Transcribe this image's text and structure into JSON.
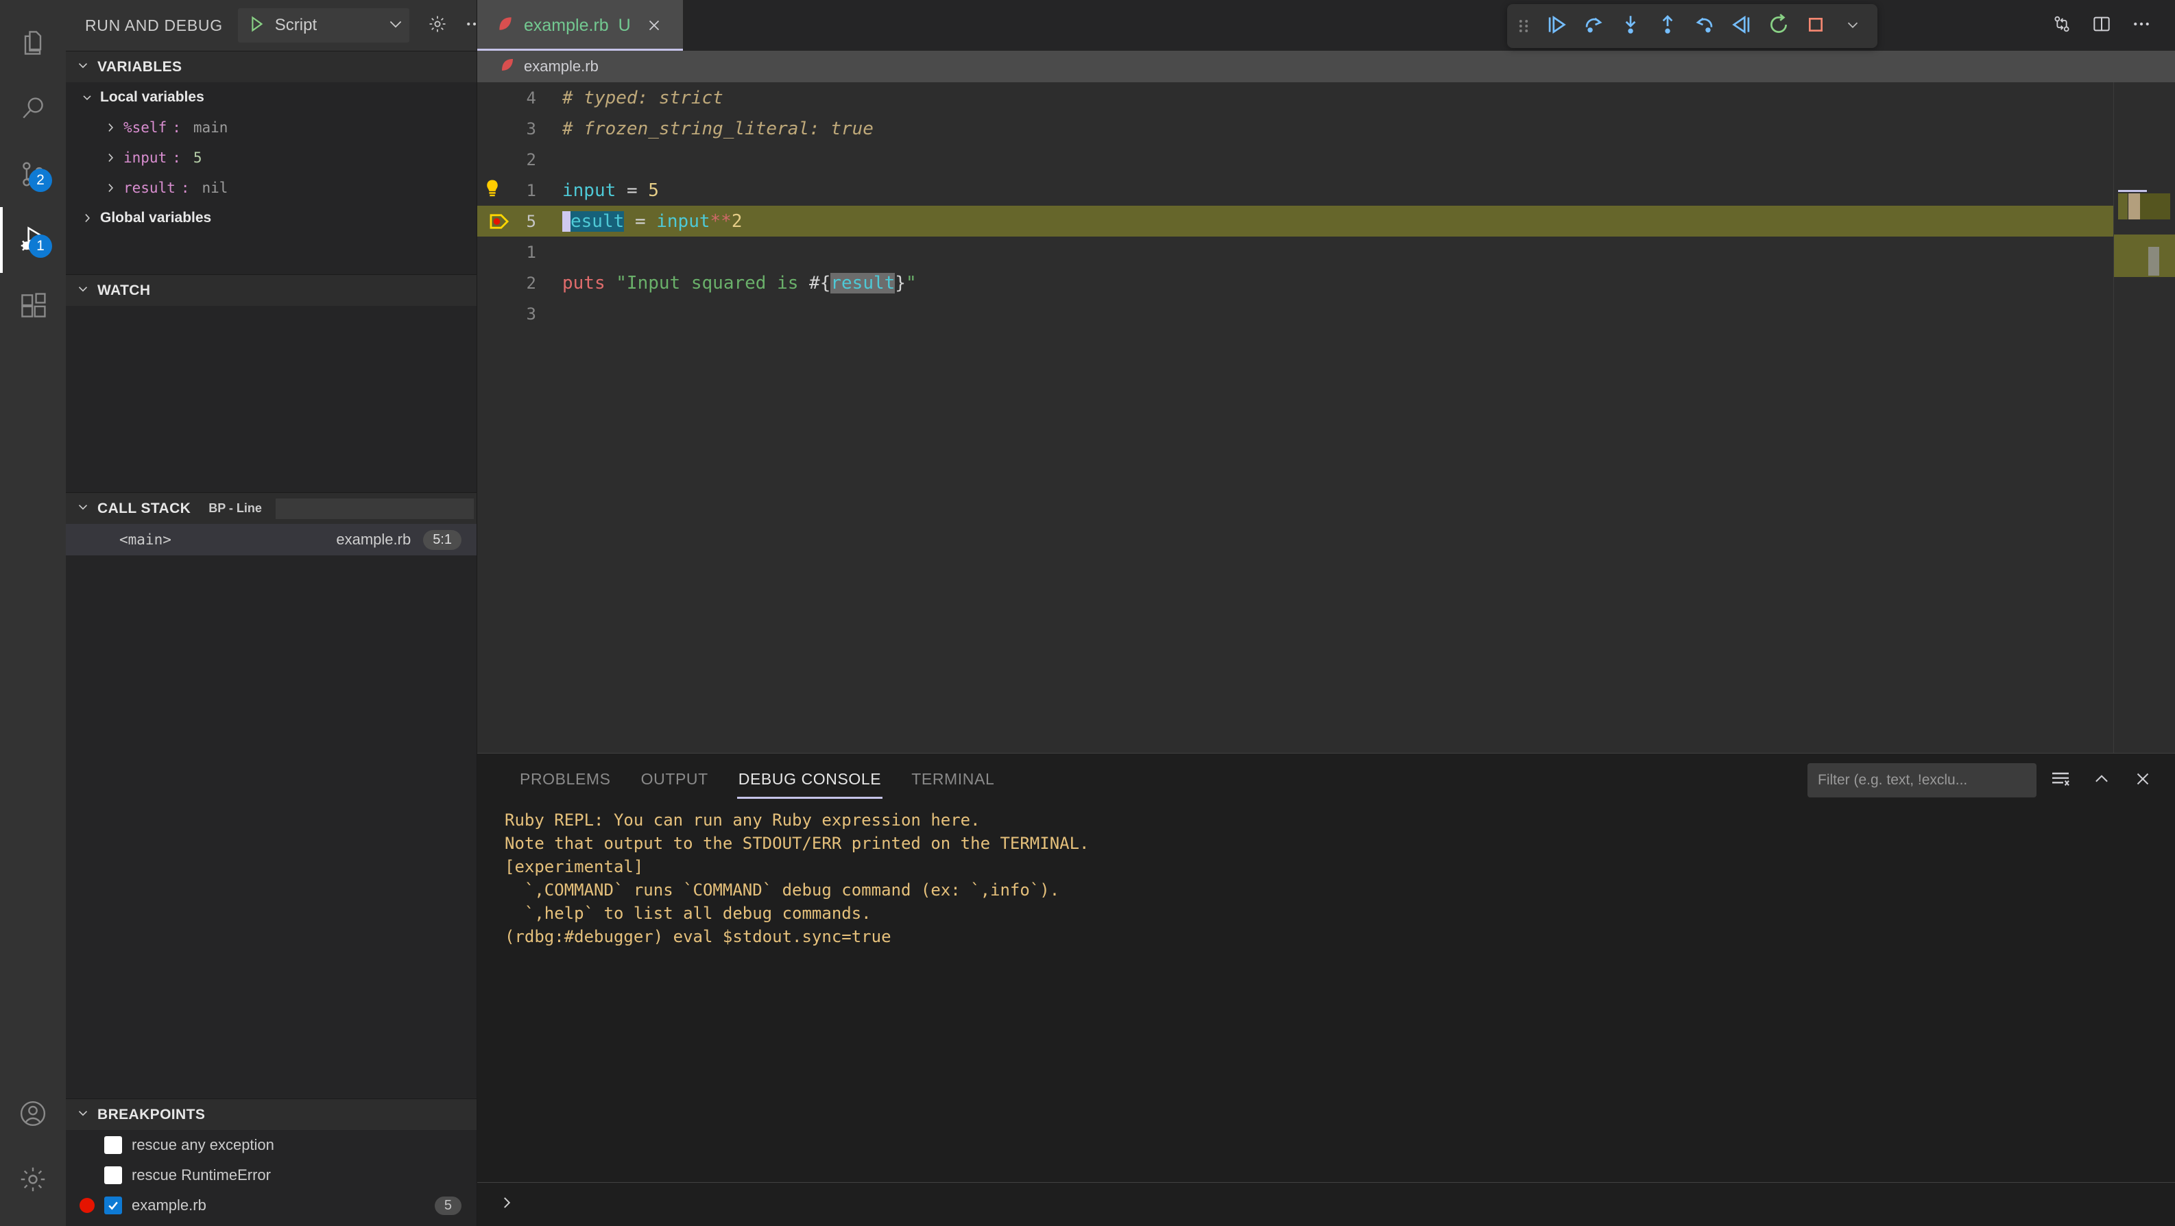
{
  "activitybar": {
    "items": [
      {
        "name": "explorer-icon",
        "label": "Explorer",
        "badge": ""
      },
      {
        "name": "search-icon",
        "label": "Search",
        "badge": ""
      },
      {
        "name": "source-control-icon",
        "label": "Source Control",
        "badge": "2"
      },
      {
        "name": "run-and-debug-icon",
        "label": "Run and Debug",
        "badge": "1"
      },
      {
        "name": "extensions-icon",
        "label": "Extensions",
        "badge": ""
      }
    ],
    "bottom": [
      {
        "name": "account-icon",
        "label": "Accounts"
      },
      {
        "name": "manage-gear-icon",
        "label": "Manage"
      }
    ]
  },
  "sidebar": {
    "title": "RUN AND DEBUG",
    "launch_configuration": "Script",
    "actions": {
      "settings_label": "Open launch.json",
      "more_label": "Views and More Actions..."
    },
    "variables": {
      "header": "VARIABLES",
      "groups": [
        {
          "label": "Local variables",
          "expanded": true,
          "items": [
            {
              "name": "%self",
              "value": "main",
              "kind": "string"
            },
            {
              "name": "input",
              "value": "5",
              "kind": "number"
            },
            {
              "name": "result",
              "value": "nil",
              "kind": "string"
            }
          ]
        },
        {
          "label": "Global variables",
          "expanded": false,
          "items": []
        }
      ]
    },
    "watch": {
      "header": "WATCH",
      "items": []
    },
    "call_stack": {
      "header": "CALL STACK",
      "status": "BP - Line",
      "frames": [
        {
          "frame": "<main>",
          "file": "example.rb",
          "position": "5:1"
        }
      ]
    },
    "breakpoints": {
      "header": "BREAKPOINTS",
      "items": [
        {
          "label": "rescue any exception",
          "checked": false,
          "line": "",
          "has_dot": false
        },
        {
          "label": "rescue RuntimeError",
          "checked": false,
          "line": "",
          "has_dot": false
        },
        {
          "label": "example.rb",
          "checked": true,
          "line": "5",
          "has_dot": true
        }
      ]
    }
  },
  "editor": {
    "tabs": [
      {
        "label": "example.rb",
        "badge": "U",
        "active": true,
        "close_label": "Close"
      }
    ],
    "tabbar_actions": [
      {
        "name": "compare-changes-icon",
        "label": "Compare Changes"
      },
      {
        "name": "split-editor-icon",
        "label": "Split Editor Right"
      },
      {
        "name": "more-actions-icon",
        "label": "More Actions..."
      }
    ],
    "breadcrumb": "example.rb",
    "debug_toolbar": [
      {
        "name": "drag-handle-icon",
        "label": "Drag"
      },
      {
        "name": "continue-icon",
        "label": "Continue"
      },
      {
        "name": "step-over-icon",
        "label": "Step Over"
      },
      {
        "name": "step-into-icon",
        "label": "Step Into"
      },
      {
        "name": "step-out-icon",
        "label": "Step Out"
      },
      {
        "name": "step-back-icon",
        "label": "Step Back"
      },
      {
        "name": "reverse-continue-icon",
        "label": "Reverse Continue"
      },
      {
        "name": "restart-icon",
        "label": "Restart"
      },
      {
        "name": "stop-icon",
        "label": "Stop"
      },
      {
        "name": "session-dropdown-icon",
        "label": "Select Session"
      }
    ],
    "lines": [
      {
        "number": "4",
        "text": "# typed: strict"
      },
      {
        "number": "3",
        "text": "# frozen_string_literal: true"
      },
      {
        "number": "2",
        "text": ""
      },
      {
        "number": "1",
        "text": "input = 5"
      },
      {
        "number": "5",
        "text": "result = input**2",
        "current": true,
        "breakpoint": true
      },
      {
        "number": "1",
        "text": ""
      },
      {
        "number": "2",
        "text": "puts \"Input squared is #{result}\""
      },
      {
        "number": "3",
        "text": ""
      }
    ],
    "cursor_position": "5:1",
    "selection": "result"
  },
  "panel": {
    "tabs": [
      {
        "label": "PROBLEMS",
        "active": false
      },
      {
        "label": "OUTPUT",
        "active": false
      },
      {
        "label": "DEBUG CONSOLE",
        "active": true
      },
      {
        "label": "TERMINAL",
        "active": false
      }
    ],
    "filter_placeholder": "Filter (e.g. text, !exclu...",
    "filter_value": "",
    "actions": [
      {
        "name": "clear-console-icon",
        "label": "Clear Console"
      },
      {
        "name": "collapse-panel-icon",
        "label": "Hide Panel"
      },
      {
        "name": "close-panel-icon",
        "label": "Close Panel"
      }
    ],
    "console_lines": [
      "Ruby REPL: You can run any Ruby expression here.",
      "Note that output to the STDOUT/ERR printed on the TERMINAL.",
      "[experimental]",
      "  `,COMMAND` runs `COMMAND` debug command (ex: `,info`).",
      "  `,help` to list all debug commands.",
      "(rdbg:#debugger) eval $stdout.sync=true"
    ],
    "repl_prompt": "›",
    "repl_value": "",
    "repl_placeholder": ""
  },
  "colors": {
    "accent": "#0e7ad4",
    "tab_active_border": "#c5c3e8",
    "breakpoint_red": "#e51400",
    "current_line": "#66662b",
    "console_text": "#e5c07b",
    "tab_label_green": "#73c991"
  }
}
